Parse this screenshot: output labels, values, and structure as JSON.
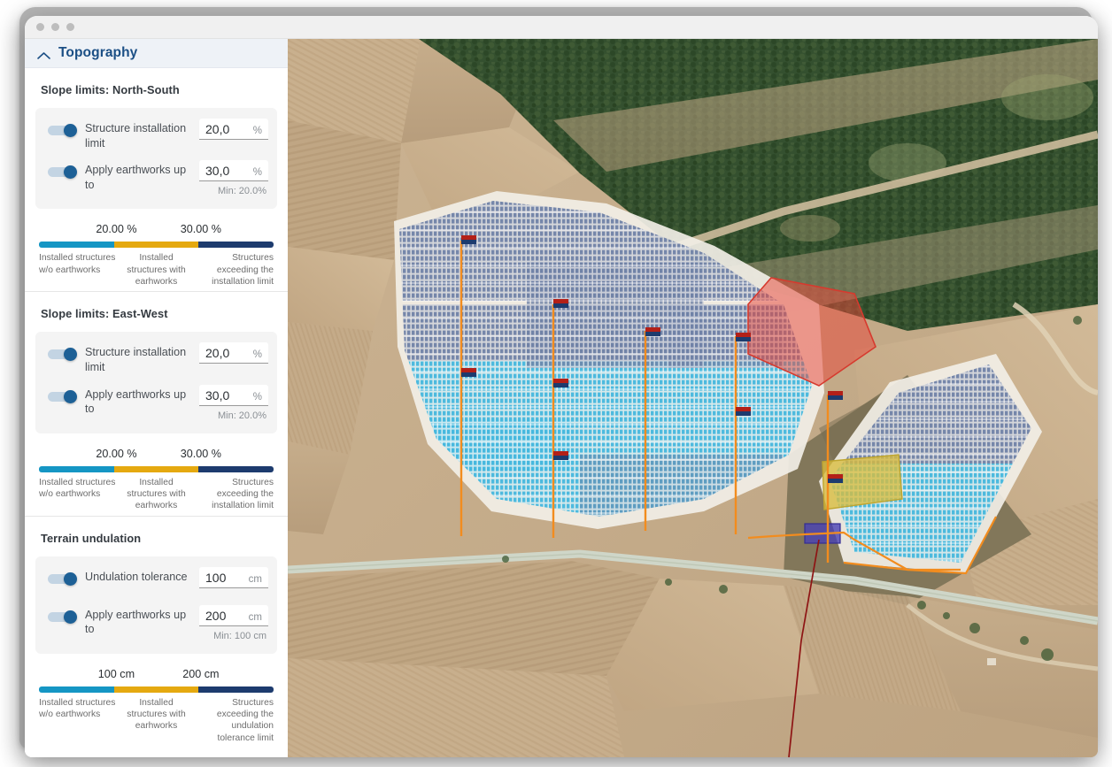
{
  "window": {
    "dots": [
      "window-dot-1",
      "window-dot-2",
      "window-dot-3"
    ]
  },
  "panel": {
    "title": "Topography",
    "collapse_icon": "chevron-up-icon"
  },
  "sections": [
    {
      "id": "north-south",
      "title": "Slope limits: North-South",
      "rows": [
        {
          "label": "Structure installation limit",
          "value": "20,0",
          "unit": "%",
          "toggle_on": true,
          "min_text": ""
        },
        {
          "label": "Apply earthworks up to",
          "value": "30,0",
          "unit": "%",
          "toggle_on": true,
          "min_text": "Min: 20.0%"
        }
      ],
      "legend": {
        "tick_low": "20.00 %",
        "tick_high": "30.00 %",
        "labels": [
          "Installed structures w/o earthworks",
          "Installed structures with earhworks",
          "Structures exceeding the installation limit"
        ],
        "colors": [
          "#1596c4",
          "#e5a910",
          "#1d3b6e"
        ]
      }
    },
    {
      "id": "east-west",
      "title": "Slope limits: East-West",
      "rows": [
        {
          "label": "Structure installation limit",
          "value": "20,0",
          "unit": "%",
          "toggle_on": true,
          "min_text": ""
        },
        {
          "label": "Apply earthworks up to",
          "value": "30,0",
          "unit": "%",
          "toggle_on": true,
          "min_text": "Min: 20.0%"
        }
      ],
      "legend": {
        "tick_low": "20.00 %",
        "tick_high": "30.00 %",
        "labels": [
          "Installed structures w/o earthworks",
          "Installed structures with earhworks",
          "Structures exceeding the installation limit"
        ],
        "colors": [
          "#1596c4",
          "#e5a910",
          "#1d3b6e"
        ]
      }
    },
    {
      "id": "terrain-undulation",
      "title": "Terrain undulation",
      "rows": [
        {
          "label": "Undulation tolerance",
          "value": "100",
          "unit": "cm",
          "toggle_on": true,
          "min_text": ""
        },
        {
          "label": "Apply earthworks up to",
          "value": "200",
          "unit": "cm",
          "toggle_on": true,
          "min_text": "Min: 100 cm"
        }
      ],
      "legend": {
        "tick_low": "100 cm",
        "tick_high": "200 cm",
        "labels": [
          "Installed structures w/o earthworks",
          "Installed structures with earhworks",
          "Structures exceeding the undulation tolerance limit"
        ],
        "colors": [
          "#1596c4",
          "#e5a910",
          "#1d3b6e"
        ]
      }
    }
  ],
  "map": {
    "type": "satellite-aerial",
    "overlays": [
      {
        "name": "solar-array-cyan",
        "color": "#46b8dd"
      },
      {
        "name": "solar-array-slate",
        "color": "#7f8fb0"
      },
      {
        "name": "exclusion-zone-red",
        "color": "#e8483c"
      },
      {
        "name": "substation-yellow",
        "color": "#d9bd3e"
      },
      {
        "name": "inverter-block-purple",
        "color": "#4941b5"
      },
      {
        "name": "site-boundary-orange",
        "color": "#f28c1e"
      },
      {
        "name": "cable-route-red",
        "color": "#8e1414"
      },
      {
        "name": "trunk-line-orange",
        "color": "#f28c1e"
      },
      {
        "name": "road-path",
        "color": "#cfd6c8"
      }
    ]
  }
}
